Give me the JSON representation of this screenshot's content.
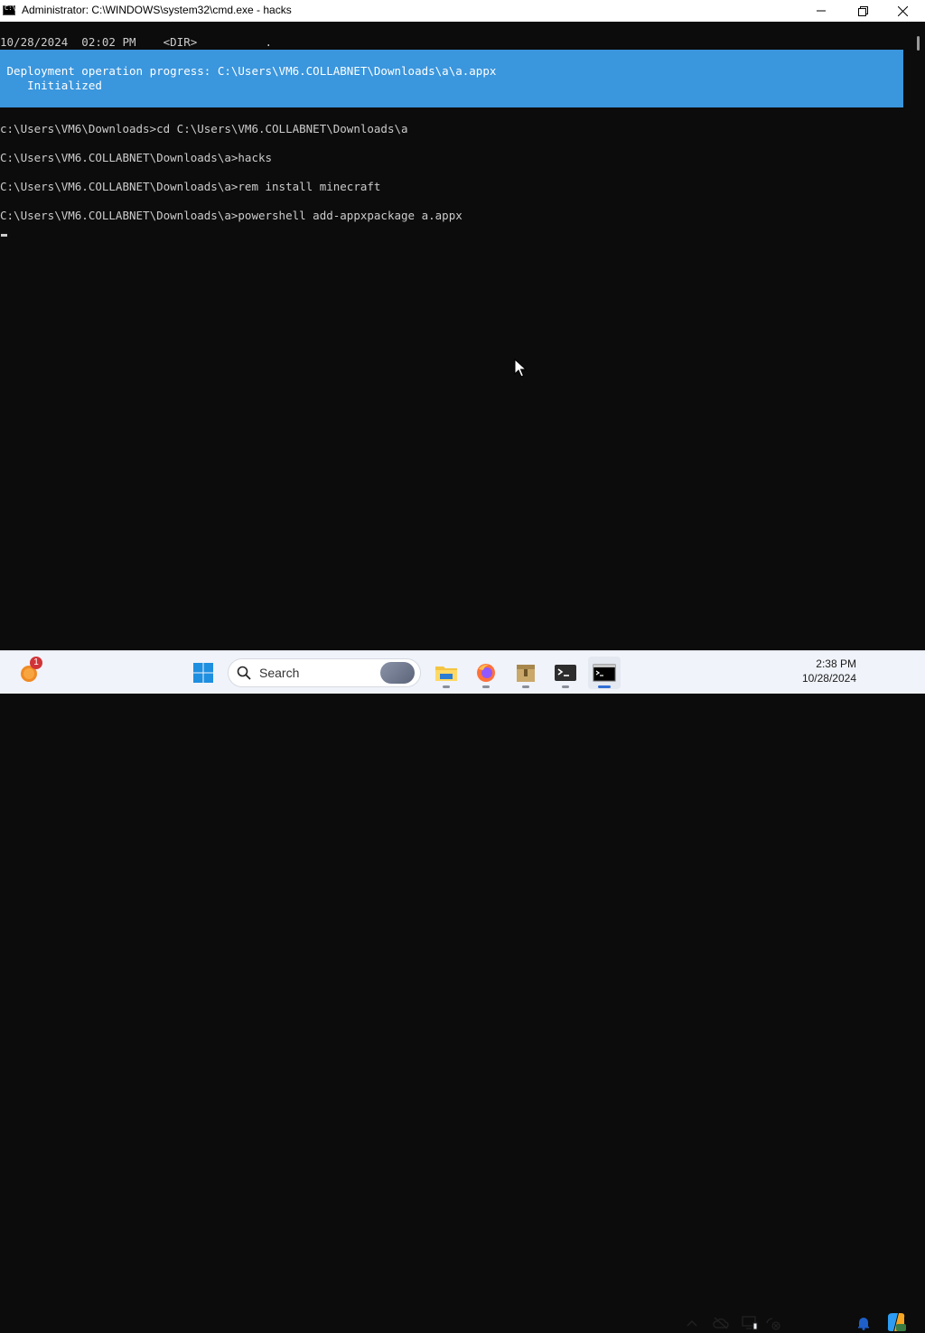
{
  "window": {
    "title": "Administrator: C:\\WINDOWS\\system32\\cmd.exe - hacks"
  },
  "console": {
    "top_line": "10/28/2024  02:02 PM    <DIR>          .",
    "progress": {
      "line1": " Deployment operation progress: C:\\Users\\VM6.COLLABNET\\Downloads\\a\\a.appx",
      "line2": "    Initialized"
    },
    "lines": [
      "c:\\Users\\VM6\\Downloads>cd C:\\Users\\VM6.COLLABNET\\Downloads\\a",
      "C:\\Users\\VM6.COLLABNET\\Downloads\\a>hacks",
      "C:\\Users\\VM6.COLLABNET\\Downloads\\a>rem install minecraft",
      "C:\\Users\\VM6.COLLABNET\\Downloads\\a>powershell add-appxpackage a.appx"
    ],
    "banner_color": "#3a96dd",
    "background_color": "#0c0c0c",
    "text_color": "#cccccc"
  },
  "taskbar": {
    "search_label": "Search",
    "notification_badge": "1",
    "time": "2:38 PM",
    "date": "10/28/2024",
    "apps": [
      "start-icon",
      "file-explorer-icon",
      "firefox-icon",
      "archive-icon",
      "terminal-icon",
      "cmd-icon"
    ],
    "tray": [
      "chevron-up-icon",
      "onedrive-offline-icon",
      "display-icon",
      "network-disconnected-icon",
      "bell-icon",
      "copilot-icon"
    ]
  }
}
